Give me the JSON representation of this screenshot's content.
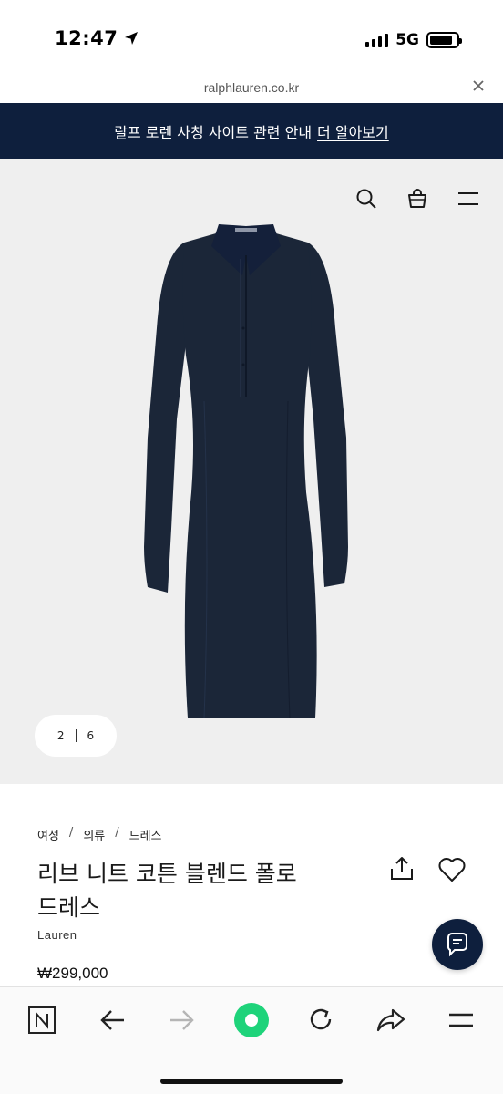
{
  "status_bar": {
    "time": "12:47",
    "network": "5G",
    "battery_level": 0.85,
    "location_icon": "location-arrow-icon"
  },
  "browser": {
    "url": "ralphlauren.co.kr",
    "close_icon": "close-icon"
  },
  "announcement": {
    "text": "랄프 로렌 사칭 사이트 관련 안내",
    "link": "더 알아보기",
    "background": "#0e1f3d"
  },
  "header_icons": [
    "search-icon",
    "shopping-bag-icon",
    "menu-icon"
  ],
  "gallery": {
    "current": "2",
    "total": "6",
    "background": "#efefef",
    "product_color": "#1b2638"
  },
  "product": {
    "breadcrumb": [
      "여성",
      "의류",
      "드레스"
    ],
    "title_line1": "리브 니트 코튼 블렌드 폴로",
    "title_line2": "드레스",
    "brand": "Lauren",
    "price": "₩299,000"
  },
  "actions": {
    "share_icon": "share-icon",
    "wishlist_icon": "heart-icon",
    "chat_icon": "chat-icon"
  },
  "toolbar": {
    "items": [
      "naver-n-icon",
      "back-arrow-icon",
      "forward-arrow-icon",
      "home-circle-icon",
      "reload-icon",
      "share-arrow-icon",
      "menu-icon"
    ],
    "accent": "#1ed37a"
  }
}
